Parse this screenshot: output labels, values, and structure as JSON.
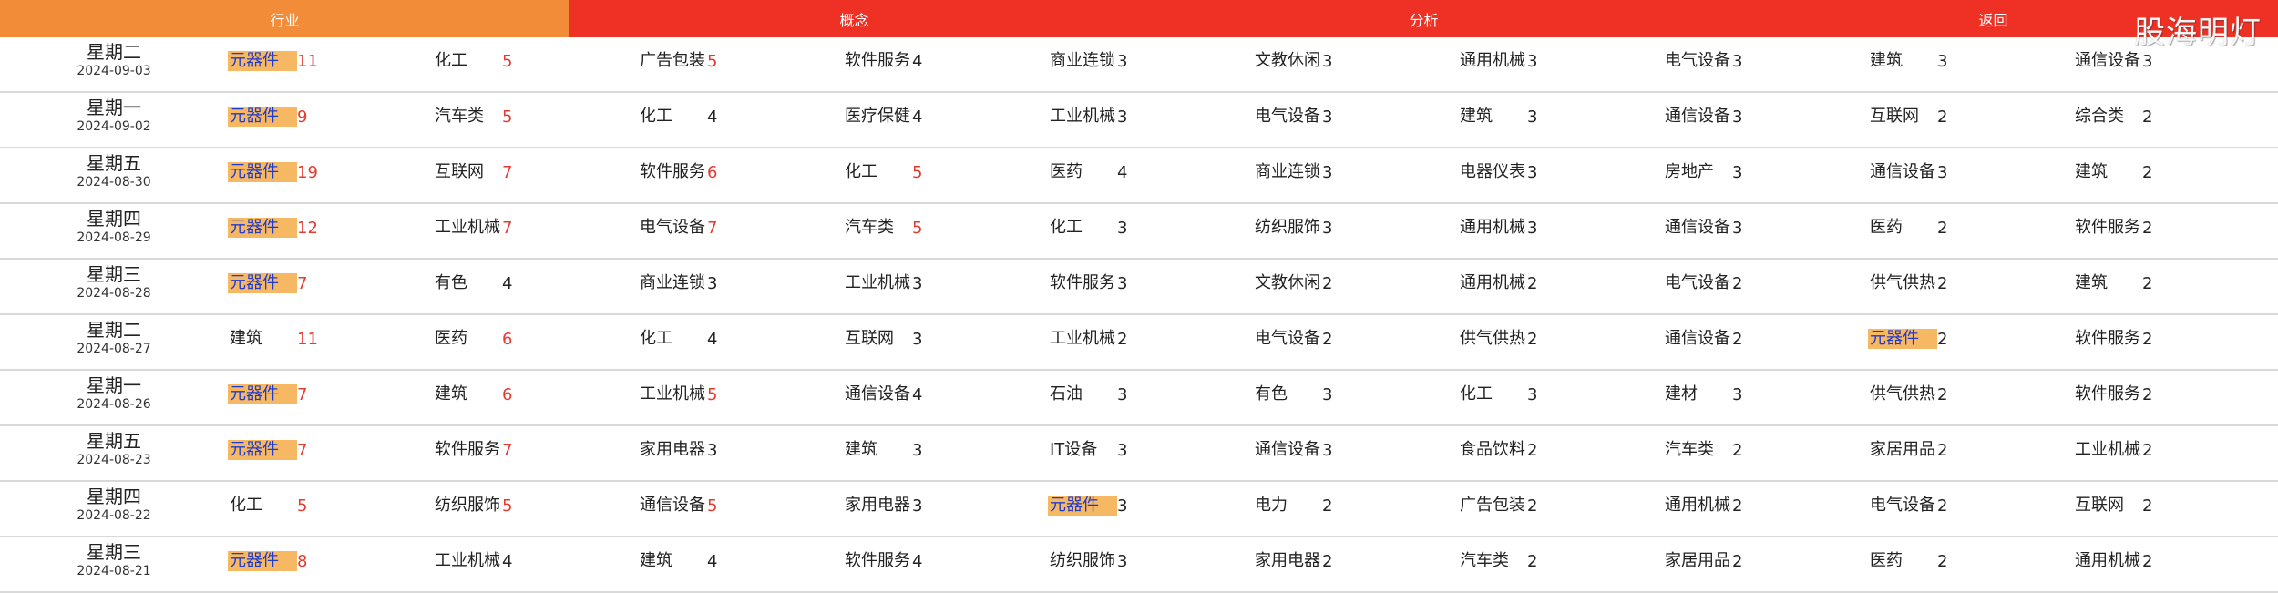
{
  "tabs": [
    {
      "label": "行业",
      "color": "#f28c38"
    },
    {
      "label": "概念",
      "color": "#ee3124"
    },
    {
      "label": "分析",
      "color": "#ee3124"
    },
    {
      "label": "返回",
      "color": "#ee3124"
    }
  ],
  "watermark": "股海明灯",
  "colors": {
    "highlight": "#f7b864",
    "highlight_text": "#1d3bd0",
    "hot_count": "#e53a2f",
    "divider": "#d9d9d9"
  },
  "rows": [
    {
      "weekday": "星期二",
      "date": "2024-09-03",
      "items": [
        {
          "name": "元器件",
          "count": "11",
          "hl": true,
          "hot": true
        },
        {
          "name": "化工",
          "count": "5",
          "hot": true
        },
        {
          "name": "广告包装",
          "count": "5",
          "hot": true
        },
        {
          "name": "软件服务",
          "count": "4"
        },
        {
          "name": "商业连锁",
          "count": "3"
        },
        {
          "name": "文教休闲",
          "count": "3"
        },
        {
          "name": "通用机械",
          "count": "3"
        },
        {
          "name": "电气设备",
          "count": "3"
        },
        {
          "name": "建筑",
          "count": "3"
        },
        {
          "name": "通信设备",
          "count": "3"
        }
      ]
    },
    {
      "weekday": "星期一",
      "date": "2024-09-02",
      "items": [
        {
          "name": "元器件",
          "count": "9",
          "hl": true,
          "hot": true
        },
        {
          "name": "汽车类",
          "count": "5",
          "hot": true
        },
        {
          "name": "化工",
          "count": "4"
        },
        {
          "name": "医疗保健",
          "count": "4"
        },
        {
          "name": "工业机械",
          "count": "3"
        },
        {
          "name": "电气设备",
          "count": "3"
        },
        {
          "name": "建筑",
          "count": "3"
        },
        {
          "name": "通信设备",
          "count": "3"
        },
        {
          "name": "互联网",
          "count": "2"
        },
        {
          "name": "综合类",
          "count": "2"
        }
      ]
    },
    {
      "weekday": "星期五",
      "date": "2024-08-30",
      "items": [
        {
          "name": "元器件",
          "count": "19",
          "hl": true,
          "hot": true
        },
        {
          "name": "互联网",
          "count": "7",
          "hot": true
        },
        {
          "name": "软件服务",
          "count": "6",
          "hot": true
        },
        {
          "name": "化工",
          "count": "5",
          "hot": true
        },
        {
          "name": "医药",
          "count": "4"
        },
        {
          "name": "商业连锁",
          "count": "3"
        },
        {
          "name": "电器仪表",
          "count": "3"
        },
        {
          "name": "房地产",
          "count": "3"
        },
        {
          "name": "通信设备",
          "count": "3"
        },
        {
          "name": "建筑",
          "count": "2"
        }
      ]
    },
    {
      "weekday": "星期四",
      "date": "2024-08-29",
      "items": [
        {
          "name": "元器件",
          "count": "12",
          "hl": true,
          "hot": true
        },
        {
          "name": "工业机械",
          "count": "7",
          "hot": true
        },
        {
          "name": "电气设备",
          "count": "7",
          "hot": true
        },
        {
          "name": "汽车类",
          "count": "5",
          "hot": true
        },
        {
          "name": "化工",
          "count": "3"
        },
        {
          "name": "纺织服饰",
          "count": "3"
        },
        {
          "name": "通用机械",
          "count": "3"
        },
        {
          "name": "通信设备",
          "count": "3"
        },
        {
          "name": "医药",
          "count": "2"
        },
        {
          "name": "软件服务",
          "count": "2"
        }
      ]
    },
    {
      "weekday": "星期三",
      "date": "2024-08-28",
      "items": [
        {
          "name": "元器件",
          "count": "7",
          "hl": true,
          "hot": true
        },
        {
          "name": "有色",
          "count": "4"
        },
        {
          "name": "商业连锁",
          "count": "3"
        },
        {
          "name": "工业机械",
          "count": "3"
        },
        {
          "name": "软件服务",
          "count": "3"
        },
        {
          "name": "文教休闲",
          "count": "2"
        },
        {
          "name": "通用机械",
          "count": "2"
        },
        {
          "name": "电气设备",
          "count": "2"
        },
        {
          "name": "供气供热",
          "count": "2"
        },
        {
          "name": "建筑",
          "count": "2"
        }
      ]
    },
    {
      "weekday": "星期二",
      "date": "2024-08-27",
      "items": [
        {
          "name": "建筑",
          "count": "11",
          "hot": true
        },
        {
          "name": "医药",
          "count": "6",
          "hot": true
        },
        {
          "name": "化工",
          "count": "4"
        },
        {
          "name": "互联网",
          "count": "3"
        },
        {
          "name": "工业机械",
          "count": "2"
        },
        {
          "name": "电气设备",
          "count": "2"
        },
        {
          "name": "供气供热",
          "count": "2"
        },
        {
          "name": "通信设备",
          "count": "2"
        },
        {
          "name": "元器件",
          "count": "2",
          "hl": true
        },
        {
          "name": "软件服务",
          "count": "2"
        }
      ]
    },
    {
      "weekday": "星期一",
      "date": "2024-08-26",
      "items": [
        {
          "name": "元器件",
          "count": "7",
          "hl": true,
          "hot": true
        },
        {
          "name": "建筑",
          "count": "6",
          "hot": true
        },
        {
          "name": "工业机械",
          "count": "5",
          "hot": true
        },
        {
          "name": "通信设备",
          "count": "4"
        },
        {
          "name": "石油",
          "count": "3"
        },
        {
          "name": "有色",
          "count": "3"
        },
        {
          "name": "化工",
          "count": "3"
        },
        {
          "name": "建材",
          "count": "3"
        },
        {
          "name": "供气供热",
          "count": "2"
        },
        {
          "name": "软件服务",
          "count": "2"
        }
      ]
    },
    {
      "weekday": "星期五",
      "date": "2024-08-23",
      "items": [
        {
          "name": "元器件",
          "count": "7",
          "hl": true,
          "hot": true
        },
        {
          "name": "软件服务",
          "count": "7",
          "hot": true
        },
        {
          "name": "家用电器",
          "count": "3"
        },
        {
          "name": "建筑",
          "count": "3"
        },
        {
          "name": "IT设备",
          "count": "3"
        },
        {
          "name": "通信设备",
          "count": "3"
        },
        {
          "name": "食品饮料",
          "count": "2"
        },
        {
          "name": "汽车类",
          "count": "2"
        },
        {
          "name": "家居用品",
          "count": "2"
        },
        {
          "name": "工业机械",
          "count": "2"
        }
      ]
    },
    {
      "weekday": "星期四",
      "date": "2024-08-22",
      "items": [
        {
          "name": "化工",
          "count": "5",
          "hot": true
        },
        {
          "name": "纺织服饰",
          "count": "5",
          "hot": true
        },
        {
          "name": "通信设备",
          "count": "5",
          "hot": true
        },
        {
          "name": "家用电器",
          "count": "3"
        },
        {
          "name": "元器件",
          "count": "3",
          "hl": true
        },
        {
          "name": "电力",
          "count": "2"
        },
        {
          "name": "广告包装",
          "count": "2"
        },
        {
          "name": "通用机械",
          "count": "2"
        },
        {
          "name": "电气设备",
          "count": "2"
        },
        {
          "name": "互联网",
          "count": "2"
        }
      ]
    },
    {
      "weekday": "星期三",
      "date": "2024-08-21",
      "items": [
        {
          "name": "元器件",
          "count": "8",
          "hl": true,
          "hot": true
        },
        {
          "name": "工业机械",
          "count": "4"
        },
        {
          "name": "建筑",
          "count": "4"
        },
        {
          "name": "软件服务",
          "count": "4"
        },
        {
          "name": "纺织服饰",
          "count": "3"
        },
        {
          "name": "家用电器",
          "count": "2"
        },
        {
          "name": "汽车类",
          "count": "2"
        },
        {
          "name": "家居用品",
          "count": "2"
        },
        {
          "name": "医药",
          "count": "2"
        },
        {
          "name": "通用机械",
          "count": "2"
        }
      ]
    }
  ]
}
